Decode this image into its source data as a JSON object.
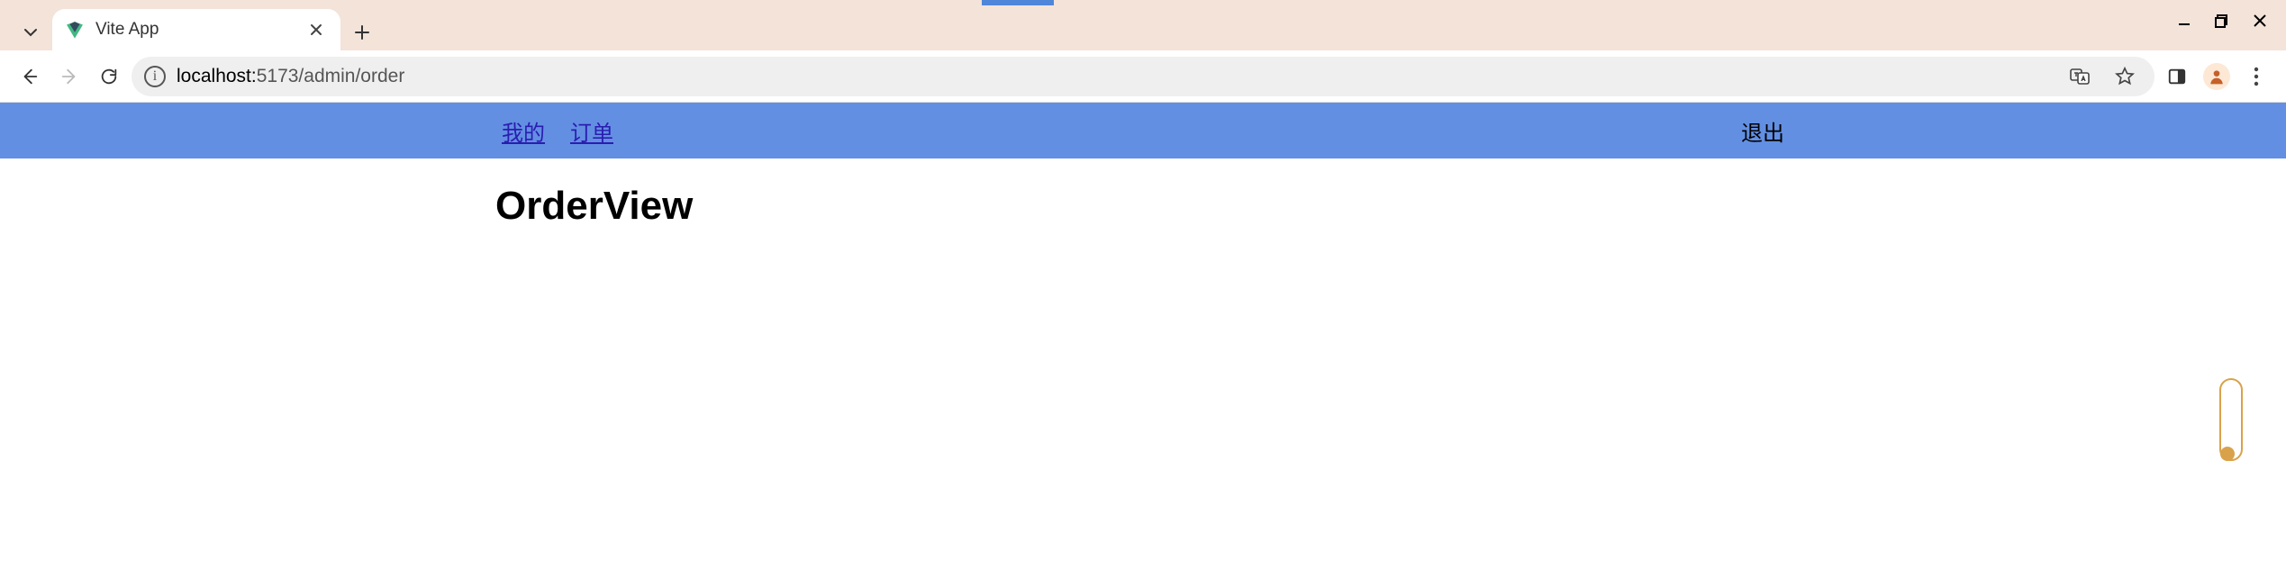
{
  "browser": {
    "tab_title": "Vite App",
    "url_host": "localhost:",
    "url_port_path": "5173/admin/order"
  },
  "app": {
    "nav": {
      "mine": "我的",
      "order": "订单",
      "logout": "退出"
    },
    "heading": "OrderView"
  }
}
